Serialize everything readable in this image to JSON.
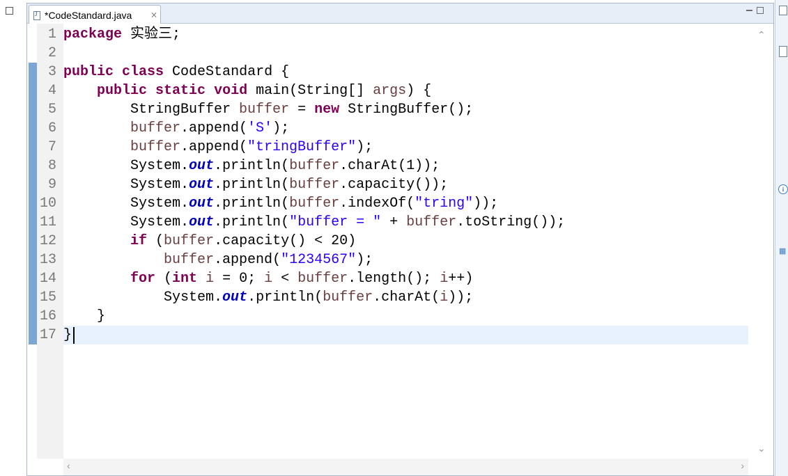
{
  "editor": {
    "tab_title": "*CodeStandard.java",
    "tab_close": "⨯"
  },
  "code_lines": [
    {
      "num": "1",
      "html": "<span class=\"kw\">package</span> 实验三;"
    },
    {
      "num": "2",
      "html": ""
    },
    {
      "num": "3",
      "html": "<span class=\"kw\">public</span> <span class=\"kw\">class</span> CodeStandard {"
    },
    {
      "num": "4",
      "html": "    <span class=\"kw\">public</span> <span class=\"kw\">static</span> <span class=\"kw\">void</span> main(String[] <span class=\"var\">args</span>) {"
    },
    {
      "num": "5",
      "html": "        StringBuffer <span class=\"var\">buffer</span> = <span class=\"kw\">new</span> StringBuffer();"
    },
    {
      "num": "6",
      "html": "        <span class=\"var\">buffer</span>.append(<span class=\"str\">'S'</span>);"
    },
    {
      "num": "7",
      "html": "        <span class=\"var\">buffer</span>.append(<span class=\"str\">\"tringBuffer\"</span>);"
    },
    {
      "num": "8",
      "html": "        System.<span class=\"fld\">out</span>.println(<span class=\"var\">buffer</span>.charAt(1));"
    },
    {
      "num": "9",
      "html": "        System.<span class=\"fld\">out</span>.println(<span class=\"var\">buffer</span>.capacity());"
    },
    {
      "num": "10",
      "html": "        System.<span class=\"fld\">out</span>.println(<span class=\"var\">buffer</span>.indexOf(<span class=\"str\">\"tring\"</span>));"
    },
    {
      "num": "11",
      "html": "        System.<span class=\"fld\">out</span>.println(<span class=\"str\">\"buffer = \"</span> + <span class=\"var\">buffer</span>.toString());"
    },
    {
      "num": "12",
      "html": "        <span class=\"kw\">if</span> (<span class=\"var\">buffer</span>.capacity() &lt; 20)"
    },
    {
      "num": "13",
      "html": "            <span class=\"var\">buffer</span>.append(<span class=\"str\">\"1234567\"</span>);"
    },
    {
      "num": "14",
      "html": "        <span class=\"kw\">for</span> (<span class=\"kw\">int</span> <span class=\"var\">i</span> = 0; <span class=\"var\">i</span> &lt; <span class=\"var\">buffer</span>.length(); <span class=\"var\">i</span>++)"
    },
    {
      "num": "15",
      "html": "            System.<span class=\"fld\">out</span>.println(<span class=\"var\">buffer</span>.charAt(<span class=\"var\">i</span>));"
    },
    {
      "num": "16",
      "html": "    }"
    },
    {
      "num": "17",
      "html": "}"
    }
  ],
  "current_line": 17,
  "colors": {
    "keyword": "#7f0055",
    "string": "#2a00ff",
    "static_field": "#0000c0",
    "local_variable": "#6a3e3e",
    "current_line_highlight": "#e8f2fe",
    "change_ruler": "#7ca6d4"
  }
}
